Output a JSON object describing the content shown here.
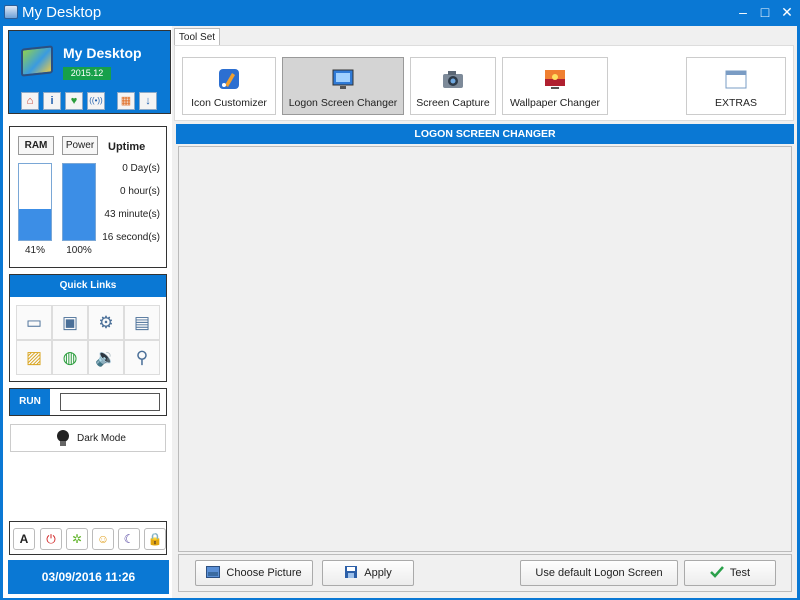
{
  "window": {
    "title": "My Desktop",
    "min": "–",
    "max": "□",
    "close": "✕"
  },
  "profile": {
    "name": "My Desktop",
    "version": "2015.12",
    "buttons": [
      "⌂",
      "i",
      "♥",
      "((•))",
      "▦",
      "↓"
    ]
  },
  "stats": {
    "ram_label": "RAM",
    "power_label": "Power",
    "ram_value": 0.41,
    "power_value": 1.0,
    "ram_text": "41%",
    "power_text": "100%",
    "uptime_title": "Uptime",
    "uptime": [
      "0 Day(s)",
      "0 hour(s)",
      "43 minute(s)",
      "16 second(s)"
    ]
  },
  "quick_links": {
    "title": "Quick Links",
    "icons": [
      "monitor-icon",
      "network-icon",
      "settings-icon",
      "display-icon",
      "folder-icon",
      "globe-icon",
      "speaker-icon",
      "usb-icon"
    ],
    "glyphs": [
      "▭",
      "▣",
      "⚙",
      "▤",
      "▨",
      "◍",
      "🔉",
      "⚲"
    ]
  },
  "run": {
    "label": "RUN",
    "value": ""
  },
  "dark_mode": {
    "label": "Dark Mode"
  },
  "bottom_buttons": [
    "A",
    "⏻",
    "✲",
    "☺",
    "☾",
    "🔒"
  ],
  "datetime": "03/09/2016  11:26",
  "tabs": [
    "Tool Set"
  ],
  "tools": [
    {
      "label": "Icon Customizer",
      "icon": "icon-customizer-icon"
    },
    {
      "label": "Logon Screen Changer",
      "icon": "logon-screen-icon"
    },
    {
      "label": "Screen Capture",
      "icon": "camera-icon"
    },
    {
      "label": "Wallpaper Changer",
      "icon": "wallpaper-icon"
    },
    {
      "label": "EXTRAS",
      "icon": "window-icon"
    }
  ],
  "panel_title": "LOGON SCREEN CHANGER",
  "actions": {
    "choose": "Choose Picture",
    "apply": "Apply",
    "default": "Use default Logon Screen",
    "test": "Test"
  },
  "colors": {
    "accent": "#0a78d4",
    "bar_fill": "#3c8ee6",
    "active_tool": "#d4d4d4"
  }
}
